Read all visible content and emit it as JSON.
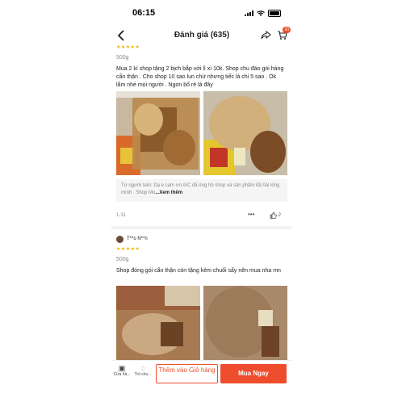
{
  "status": {
    "time": "06:15"
  },
  "header": {
    "title": "Đánh giá (635)",
    "cart_count": "20"
  },
  "review1": {
    "stars": "★★★★★",
    "variant": "500g",
    "text": "Mua 2 kí shop tặng 2 bịch bắp với lì xì 10k. Shop chu đáo gói hàng cẩn thận . Cho shop 10 sao lun chứ nhưng tiếc là chỉ 5 sao . Ok lắm nhé mọi người . Ngon bổ rẻ là đây",
    "seller_label": "Từ người bán:",
    "seller_text": "Dạ e cam ơn A/C đã ủng hộ shop và sản phẩm đã hài lòng mình . Shop Mo",
    "see_more": "...Xem thêm",
    "date": "1-31",
    "likes": "2"
  },
  "review2": {
    "user": "T**o N**n",
    "stars": "★★★★★",
    "variant": "500g",
    "text": "Shop đóng gói cẩn thận còn tặng kèm chuối sấy nên mua nha mn"
  },
  "bottom": {
    "shop_label": "Cửa hà...",
    "chat_label": "Trò chu...",
    "add_to_cart": "Thêm vào Giỏ hàng",
    "buy_now": "Mua Ngay"
  }
}
